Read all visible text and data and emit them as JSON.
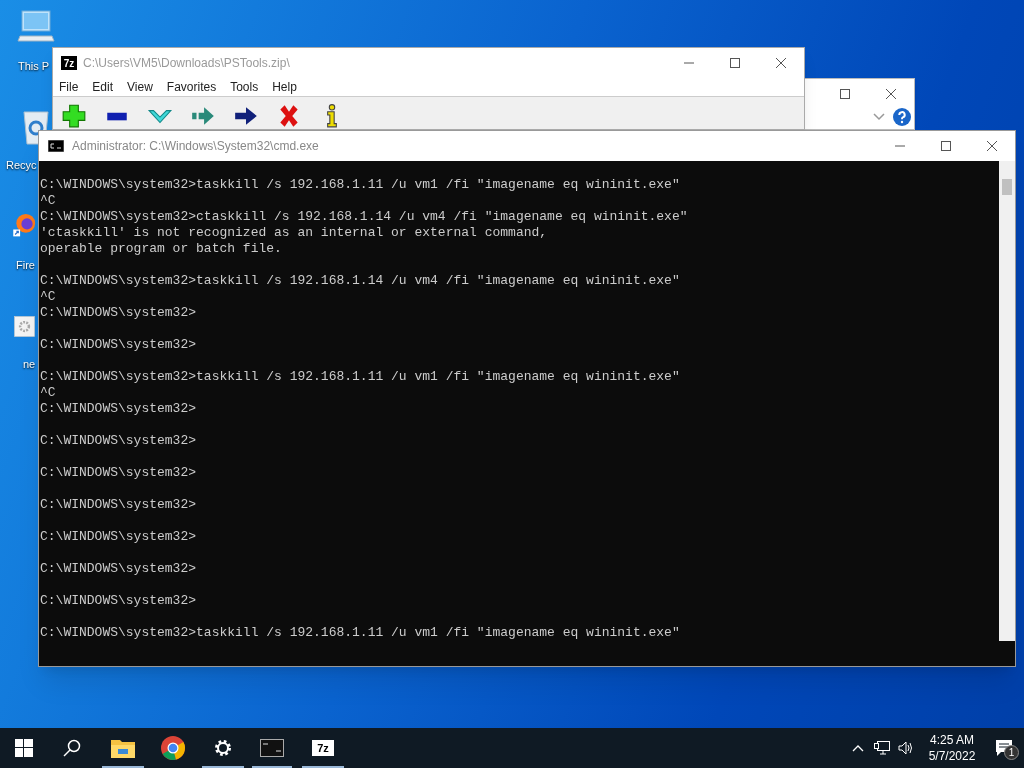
{
  "desktop_icons": [
    {
      "kind": "computer",
      "label": "This P"
    },
    {
      "kind": "recycle",
      "label": "Recyc"
    },
    {
      "kind": "browser",
      "label": "Fire"
    },
    {
      "kind": "file",
      "label": "ne"
    }
  ],
  "archive_window": {
    "logo_text": "7z",
    "title": "C:\\Users\\VM5\\Downloads\\PSTools.zip\\",
    "menu": [
      "File",
      "Edit",
      "View",
      "Favorites",
      "Tools",
      "Help"
    ],
    "toolbar": [
      {
        "kind": "add"
      },
      {
        "kind": "extract"
      },
      {
        "kind": "test"
      },
      {
        "kind": "copy"
      },
      {
        "kind": "move"
      },
      {
        "kind": "delete"
      },
      {
        "kind": "info"
      }
    ]
  },
  "console_window": {
    "title": "Administrator: C:\\Windows\\System32\\cmd.exe",
    "blocks": [
      [
        "C:\\WINDOWS\\system32>taskkill /s 192.168.1.11 /u vm1 /fi \"imagename eq wininit.exe\"",
        "^C",
        "C:\\WINDOWS\\system32>ctaskkill /s 192.168.1.14 /u vm4 /fi \"imagename eq wininit.exe\"",
        "'ctaskkill' is not recognized as an internal or external command,",
        "operable program or batch file."
      ],
      [
        "C:\\WINDOWS\\system32>taskkill /s 192.168.1.14 /u vm4 /fi \"imagename eq wininit.exe\"",
        "^C",
        "C:\\WINDOWS\\system32>"
      ],
      [
        "C:\\WINDOWS\\system32>"
      ],
      [
        "C:\\WINDOWS\\system32>taskkill /s 192.168.1.11 /u vm1 /fi \"imagename eq wininit.exe\"",
        "^C",
        "C:\\WINDOWS\\system32>"
      ],
      [
        "C:\\WINDOWS\\system32>"
      ],
      [
        "C:\\WINDOWS\\system32>"
      ],
      [
        "C:\\WINDOWS\\system32>"
      ],
      [
        "C:\\WINDOWS\\system32>"
      ],
      [
        "C:\\WINDOWS\\system32>"
      ],
      [
        "C:\\WINDOWS\\system32>"
      ],
      [
        "C:\\WINDOWS\\system32>taskkill /s 192.168.1.11 /u vm1 /fi \"imagename eq wininit.exe\""
      ]
    ]
  },
  "taskbar": {
    "apps": [
      {
        "kind": "start",
        "running": false
      },
      {
        "kind": "search",
        "running": false
      },
      {
        "kind": "folder",
        "running": true
      },
      {
        "kind": "browser",
        "running": false
      },
      {
        "kind": "settings",
        "running": true
      },
      {
        "kind": "terminal",
        "running": true
      },
      {
        "kind": "archiver",
        "running": true,
        "logo_text": "7z"
      }
    ],
    "time": "4:25 AM",
    "date": "5/7/2022",
    "notification_badge": "1"
  }
}
